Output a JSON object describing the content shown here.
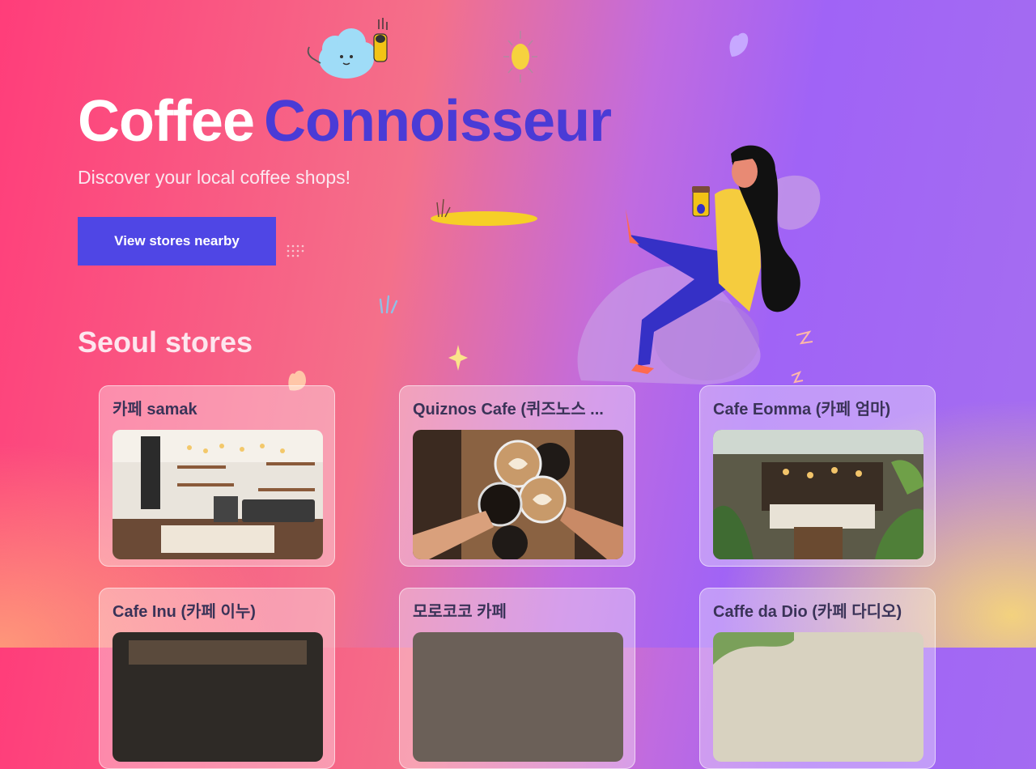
{
  "hero": {
    "title_part1": "Coffee",
    "title_part2": "Connoisseur",
    "subtitle": "Discover your local coffee shops!",
    "cta_label": "View stores nearby"
  },
  "section": {
    "title": "Seoul stores"
  },
  "stores": [
    {
      "name": "카페 samak",
      "photo": "cafe-counter"
    },
    {
      "name": "Quiznos Cafe (퀴즈노스 ...",
      "photo": "latte-cheers"
    },
    {
      "name": "Cafe Eomma (카페 엄마)",
      "photo": "greenhouse-cafe"
    },
    {
      "name": "Cafe Inu (카페 이누)",
      "photo": "cafe-interior"
    },
    {
      "name": "모로코코 카페",
      "photo": "coffee-table"
    },
    {
      "name": "Caffe da Dio (카페 다디오)",
      "photo": "garden-cafe"
    }
  ],
  "colors": {
    "accent": "#4f46e5",
    "title_accent": "#4a3bd6",
    "gradient_left": "#ff3d7a",
    "gradient_right": "#a063f6"
  }
}
